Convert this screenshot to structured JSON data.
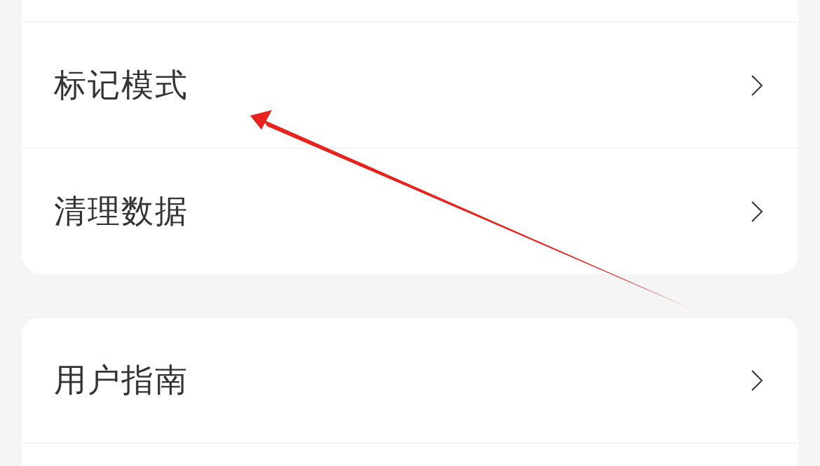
{
  "sections": [
    {
      "items": [
        {
          "label": "标记模式"
        },
        {
          "label": "清理数据"
        }
      ]
    },
    {
      "items": [
        {
          "label": "用户指南"
        }
      ]
    }
  ],
  "annotation": {
    "kind": "arrow"
  }
}
